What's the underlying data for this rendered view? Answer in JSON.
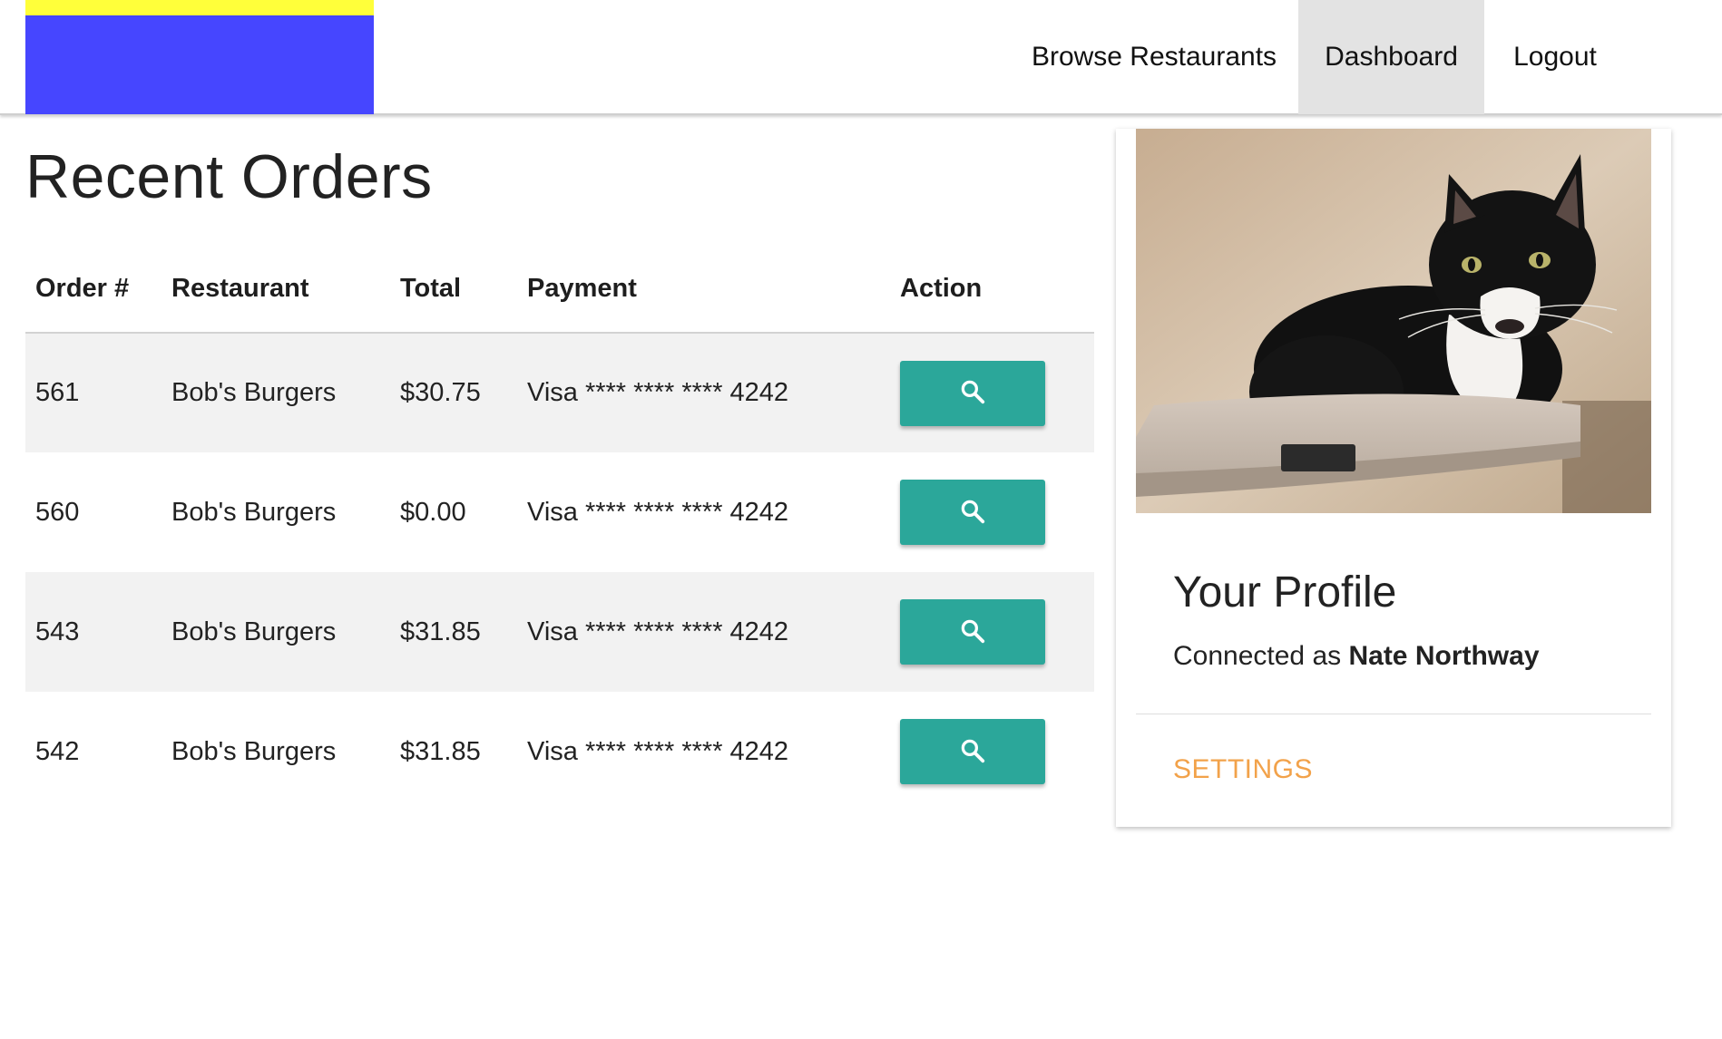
{
  "colors": {
    "logo_blue": "#4646ff",
    "logo_yellow": "#ffff3a",
    "button_teal": "#2ba79a",
    "active_nav_bg": "#e3e3e3",
    "settings_orange": "#f2a24a"
  },
  "nav": {
    "links": [
      {
        "label": "Browse Restaurants",
        "active": false
      },
      {
        "label": "Dashboard",
        "active": true
      },
      {
        "label": "Logout",
        "active": false
      }
    ]
  },
  "orders": {
    "title": "Recent Orders",
    "columns": [
      "Order #",
      "Restaurant",
      "Total",
      "Payment",
      "Action"
    ],
    "rows": [
      {
        "order": "561",
        "restaurant": "Bob's Burgers",
        "total": "$30.75",
        "payment": "Visa **** **** **** 4242",
        "action_icon": "search-icon"
      },
      {
        "order": "560",
        "restaurant": "Bob's Burgers",
        "total": "$0.00",
        "payment": "Visa **** **** **** 4242",
        "action_icon": "search-icon"
      },
      {
        "order": "543",
        "restaurant": "Bob's Burgers",
        "total": "$31.85",
        "payment": "Visa **** **** **** 4242",
        "action_icon": "search-icon"
      },
      {
        "order": "542",
        "restaurant": "Bob's Burgers",
        "total": "$31.85",
        "payment": "Visa **** **** **** 4242",
        "action_icon": "search-icon"
      }
    ]
  },
  "profile": {
    "photo_subject": "tuxedo cat on cat-tree perch",
    "title": "Your Profile",
    "connected_prefix": "Connected as ",
    "user_name": "Nate Northway",
    "settings_label": "SETTINGS"
  }
}
